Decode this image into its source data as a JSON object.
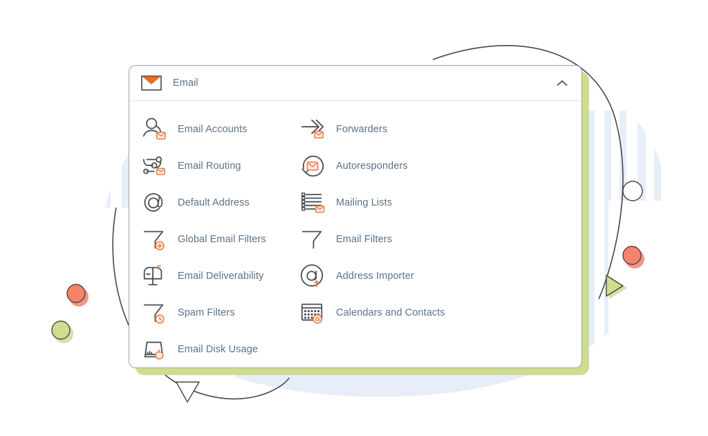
{
  "palette": {
    "page_background": "#ffffff",
    "card_background": "#ffffff",
    "card_border": "#9aa3ac",
    "card_shadow_green": "#cfdd8e",
    "link_text": "#5c7189",
    "icon_stroke": "#4a4f55",
    "icon_accent_orange": "#ef7b45",
    "accent_orange_fill": "#f47a52",
    "accent_green_fill": "#cfdd8e",
    "background_blob_blue": "#e4ecf8",
    "divider": "#e6e8ea"
  },
  "card": {
    "header": {
      "icon": "envelope-icon",
      "title": "Email",
      "collapse_icon": "chevron-up-icon",
      "collapse_state": "expanded"
    },
    "columns": [
      {
        "name": "left-column",
        "items": [
          {
            "icon": "user-with-envelope-icon",
            "label": "Email Accounts"
          },
          {
            "icon": "routing-nodes-envelope-icon",
            "label": "Email Routing"
          },
          {
            "icon": "at-sign-icon",
            "label": "Default Address"
          },
          {
            "icon": "funnel-plus-icon",
            "label": "Global Email Filters"
          },
          {
            "icon": "mailbox-icon",
            "label": "Email Deliverability"
          },
          {
            "icon": "funnel-clock-icon",
            "label": "Spam Filters"
          },
          {
            "icon": "disk-usage-icon",
            "label": "Email Disk Usage"
          }
        ]
      },
      {
        "name": "right-column",
        "items": [
          {
            "icon": "forward-arrows-envelope-icon",
            "label": "Forwarders"
          },
          {
            "icon": "refresh-envelope-icon",
            "label": "Autoresponders"
          },
          {
            "icon": "list-envelope-icon",
            "label": "Mailing Lists"
          },
          {
            "icon": "funnel-icon",
            "label": "Email Filters"
          },
          {
            "icon": "at-circle-import-icon",
            "label": "Address Importer"
          },
          {
            "icon": "calendar-at-icon",
            "label": "Calendars and Contacts"
          }
        ]
      }
    ]
  },
  "decorations": [
    {
      "name": "background-blue-blob",
      "shape": "ellipse",
      "color": "#e4ecf8"
    },
    {
      "name": "background-stripe-bars",
      "shape": "bars",
      "color": "#ffffff"
    },
    {
      "name": "swoosh-line-top-right",
      "shape": "curve",
      "color": "#3f4348"
    },
    {
      "name": "swoosh-line-bottom-left",
      "shape": "curve",
      "color": "#3f4348"
    },
    {
      "name": "orange-circle-left",
      "shape": "circle",
      "color": "#f4836a"
    },
    {
      "name": "green-circle-left",
      "shape": "circle",
      "color": "#cfdd8e"
    },
    {
      "name": "outline-circle-right",
      "shape": "circle",
      "color": "#ffffff"
    },
    {
      "name": "orange-circle-right",
      "shape": "circle",
      "color": "#f4836a"
    },
    {
      "name": "green-triangle-right",
      "shape": "triangle",
      "color": "#cfdd8e"
    },
    {
      "name": "outline-triangle-bottom",
      "shape": "triangle",
      "color": "#ffffff"
    }
  ]
}
